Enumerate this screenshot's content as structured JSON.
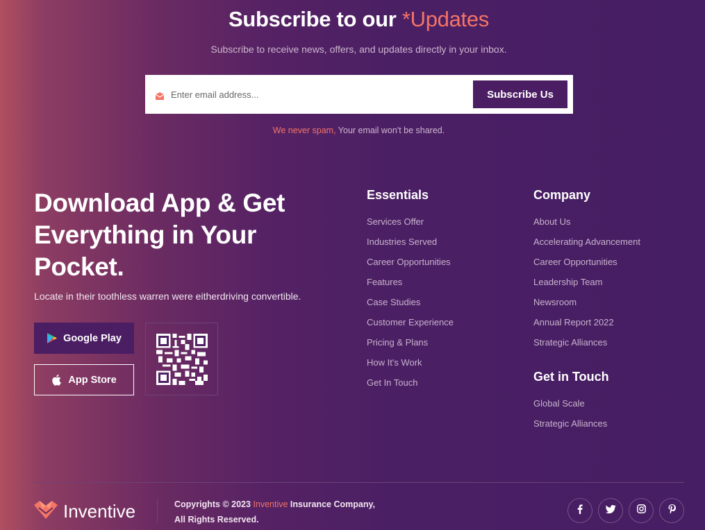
{
  "subscribe": {
    "title_main": "Subscribe to our",
    "title_accent": "*Updates",
    "subtitle": "Subscribe to receive news, offers, and updates directly in your inbox.",
    "email_placeholder": "Enter email address...",
    "button_label": "Subscribe Us",
    "note_warning": "We never spam,",
    "note_rest": " Your email won't be shared."
  },
  "app": {
    "title": "Download App & Get Everything in Your Pocket.",
    "description": "Locate in their toothless warren were eitherdriving convertible.",
    "google_play_label": "Google Play",
    "app_store_label": "App Store"
  },
  "essentials": {
    "title": "Essentials",
    "items": [
      "Services Offer",
      "Industries Served",
      "Career Opportunities",
      "Features",
      "Case Studies",
      "Customer Experience",
      "Pricing & Plans",
      "How It's Work",
      "Get In Touch"
    ]
  },
  "company": {
    "title": "Company",
    "items": [
      "About Us",
      "Accelerating Advancement",
      "Career Opportunities",
      "Leadership Team",
      "Newsroom",
      "Annual Report 2022",
      "Strategic Alliances"
    ]
  },
  "get_in_touch": {
    "title": "Get in Touch",
    "items": [
      "Global Scale",
      "Strategic Alliances"
    ]
  },
  "footer": {
    "logo_text": "Inventive",
    "copyright_prefix": "Copyrights © 2023 ",
    "copyright_brand": "Inventive",
    "copyright_suffix": " Insurance Company,",
    "rights": "All Rights Reserved.",
    "social_icons": [
      "facebook-icon",
      "twitter-icon",
      "instagram-icon",
      "pinterest-icon"
    ]
  },
  "colors": {
    "accent": "#f47466",
    "primary": "#4b1d63"
  }
}
